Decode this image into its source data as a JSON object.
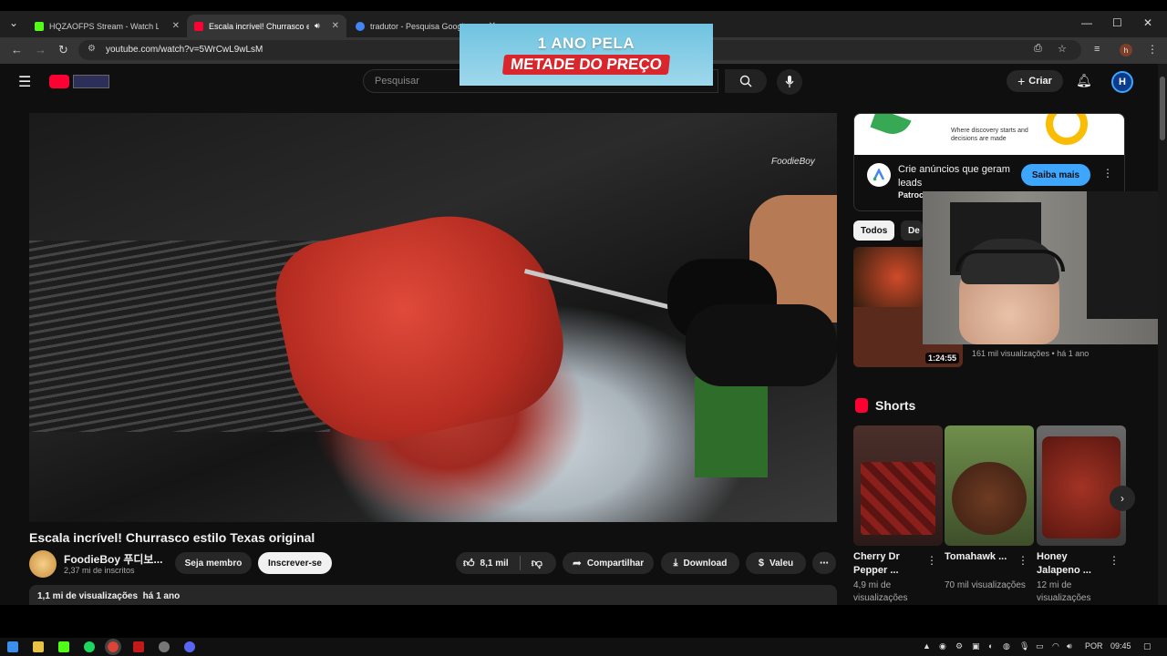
{
  "browser": {
    "tabs": [
      {
        "title": "HQZAOFPS Stream - Watch Live",
        "favicon_color": "#53fc18"
      },
      {
        "title": "Escala incrível! Churrasco e",
        "favicon_color": "#ff0033"
      },
      {
        "title": "tradutor - Pesquisa Google",
        "favicon_color": "#4285f4"
      }
    ],
    "url": "youtube.com/watch?v=5WrCwL9wLsM"
  },
  "promo": {
    "line1": "1 ANO PELA",
    "line2": "METADE DO PREÇO"
  },
  "header": {
    "search_placeholder": "Pesquisar",
    "create_label": "Criar"
  },
  "video": {
    "watermark": "FoodieBoy",
    "title": "Escala incrível! Churrasco estilo Texas original",
    "channel": "FoodieBoy 푸디보...",
    "subscribers": "2,37 mi de inscritos",
    "join_label": "Seja membro",
    "subscribe_label": "Inscrever-se",
    "likes": "8,1 mil",
    "share_label": "Compartilhar",
    "download_label": "Download",
    "thanks_label": "Valeu",
    "views_line": "1,1 mi de visualizações  há 1 ano"
  },
  "ad": {
    "image_text": "Where discovery starts and decisions are made",
    "headline": "Crie anúncios que geram leads",
    "sponsored": "Patroc",
    "cta": "Saiba mais"
  },
  "chips": [
    "Todos",
    "De"
  ],
  "related": {
    "duration": "1:24:55",
    "meta": "161 mil visualizações • há 1 ano"
  },
  "shorts": {
    "section_title": "Shorts",
    "items": [
      {
        "title": "Cherry Dr Pepper ...",
        "views": "4,9 mi de visualizações"
      },
      {
        "title": "Tomahawk ...",
        "views": "70 mil visualizações"
      },
      {
        "title": "Honey Jalapeno ...",
        "views": "12 mi de visualizações"
      }
    ]
  },
  "taskbar": {
    "lang": "POR",
    "time": "09:45"
  }
}
